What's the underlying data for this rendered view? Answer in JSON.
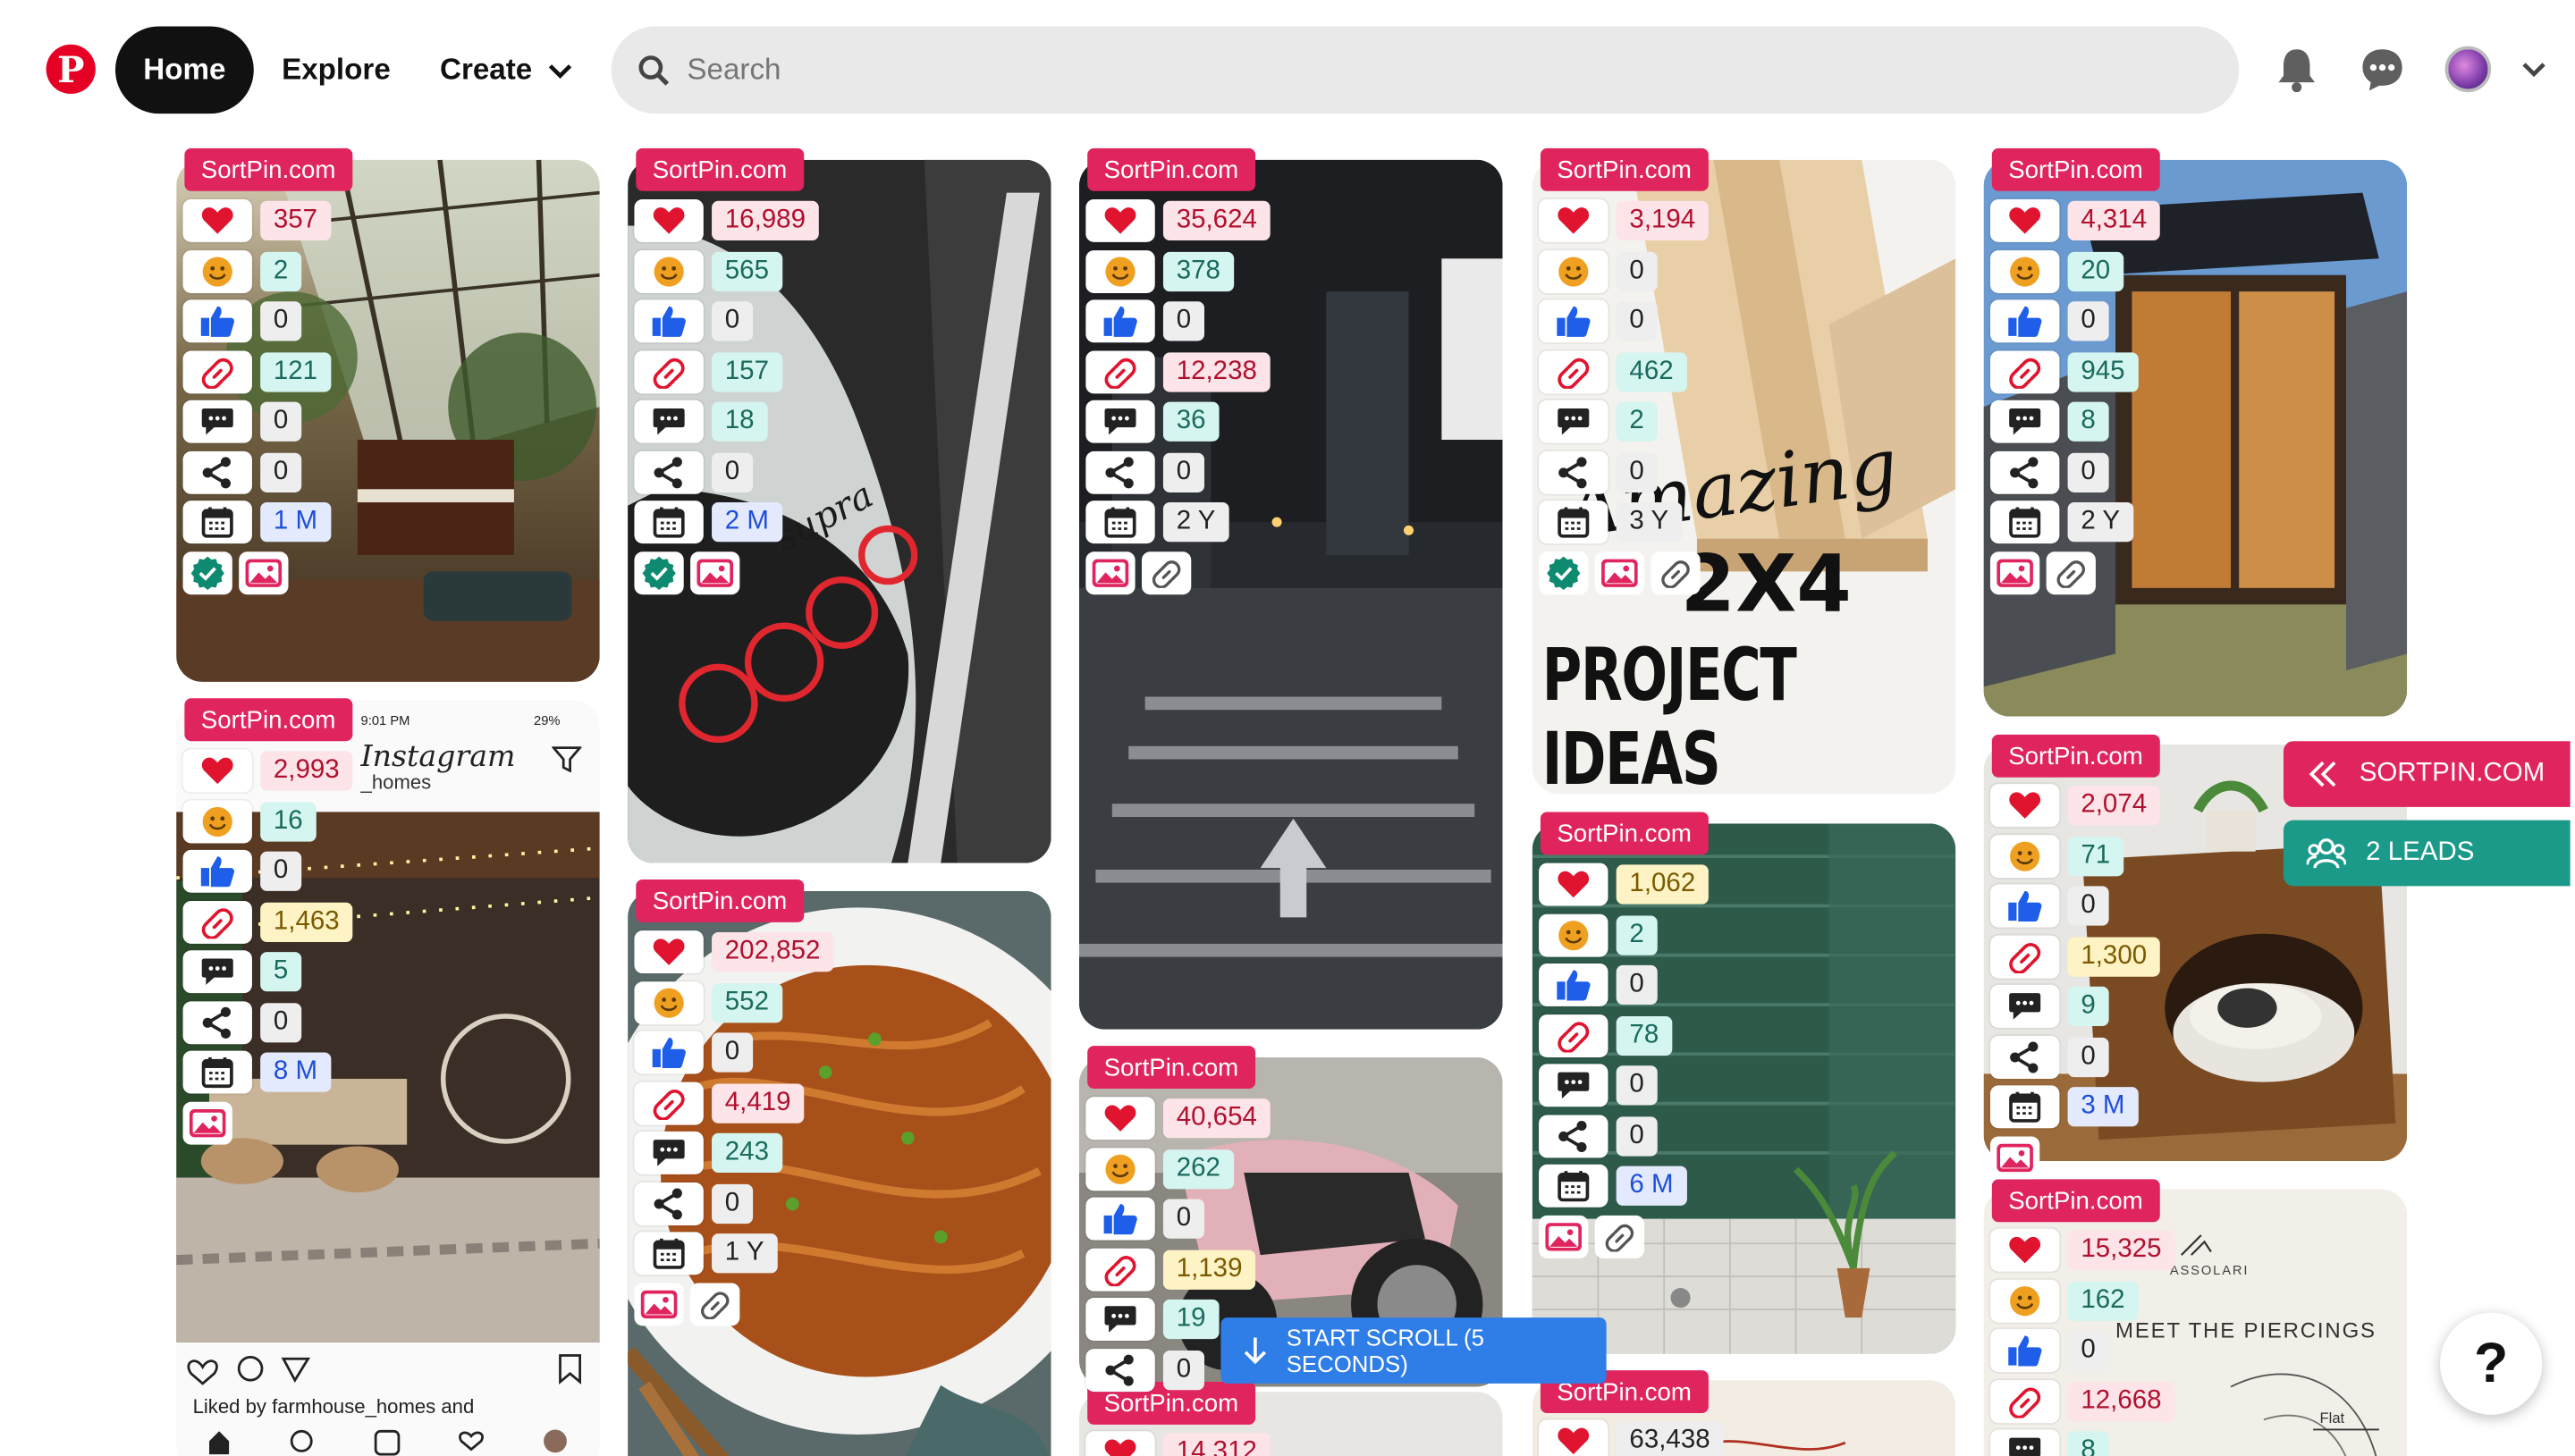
{
  "header": {
    "logo_letter": "P",
    "home_label": "Home",
    "explore_label": "Explore",
    "create_label": "Create",
    "search_placeholder": "Search"
  },
  "brand_tag": "SortPin.com",
  "colors": {
    "pinterest_red": "#e60023",
    "tag_pink": "#e0245e",
    "sortpin_button": "#e0245e",
    "leads_button": "#1b9a8a",
    "scroll_button": "#2f7de6"
  },
  "icons": [
    "heart-icon",
    "smiley-icon",
    "thumbs-up-icon",
    "link-icon",
    "comment-icon",
    "share-icon",
    "calendar-icon",
    "verified-icon",
    "image-icon"
  ],
  "pins": [
    {
      "stats": {
        "hearts": "357",
        "smiles": "2",
        "likes": "0",
        "links": "121",
        "comments": "0",
        "shares": "0",
        "age": "1 M"
      }
    },
    {
      "stats": {
        "hearts": "16,989",
        "smiles": "565",
        "likes": "0",
        "links": "157",
        "comments": "18",
        "shares": "0",
        "age": "2 M"
      }
    },
    {
      "stats": {
        "hearts": "35,624",
        "smiles": "378",
        "likes": "0",
        "links": "12,238",
        "comments": "36",
        "shares": "0",
        "age": "2 Y"
      }
    },
    {
      "stats": {
        "hearts": "3,194",
        "smiles": "0",
        "likes": "0",
        "links": "462",
        "comments": "2",
        "shares": "0",
        "age": "3 Y"
      }
    },
    {
      "stats": {
        "hearts": "4,314",
        "smiles": "20",
        "likes": "0",
        "links": "945",
        "comments": "8",
        "shares": "0",
        "age": "2 Y"
      }
    },
    {
      "stats": {
        "hearts": "2,993",
        "smiles": "16",
        "likes": "0",
        "links": "1,463",
        "comments": "5",
        "shares": "0",
        "age": "8 M"
      }
    },
    {
      "stats": {
        "hearts": "202,852",
        "smiles": "552",
        "likes": "0",
        "links": "4,419",
        "comments": "243",
        "shares": "0",
        "age": "1 Y"
      }
    },
    {
      "stats": {
        "hearts": "40,654",
        "smiles": "262",
        "likes": "0",
        "links": "1,139",
        "comments": "19",
        "shares": "0"
      }
    },
    {
      "stats": {
        "hearts": "1,062",
        "smiles": "2",
        "likes": "0",
        "links": "78",
        "comments": "0",
        "shares": "0",
        "age": "6 M"
      }
    },
    {
      "stats": {
        "hearts": "2,074",
        "smiles": "71",
        "likes": "0",
        "links": "1,300",
        "comments": "9",
        "shares": "0",
        "age": "3 M"
      }
    },
    {
      "stats": {
        "hearts": "15,325",
        "smiles": "162",
        "likes": "0",
        "links": "12,668",
        "comments": "8"
      }
    },
    {
      "stats": {
        "hearts": "14,312"
      }
    },
    {
      "stats": {
        "hearts": "63,438"
      }
    }
  ],
  "overlays": {
    "project_ideas_line1": "Amazing",
    "project_ideas_line2": "2X4",
    "project_ideas_line3": "PROJECT IDEAS",
    "instagram_time": "9:01 PM",
    "instagram_battery": "29%",
    "instagram_logo": "Instagram",
    "instagram_handle": "_homes",
    "instagram_liked": "Liked by farmhouse_homes and",
    "piercing_brand": "ASSOLARI",
    "piercing_title": "MEET THE PIERCINGS",
    "piercing_flat": "Flat",
    "supra_badge": "supra"
  },
  "side": {
    "sortpin_label": "SORTPIN.COM",
    "leads_label": "2 LEADS"
  },
  "scroll_label": "START SCROLL (5 SECONDS)",
  "help_label": "?"
}
